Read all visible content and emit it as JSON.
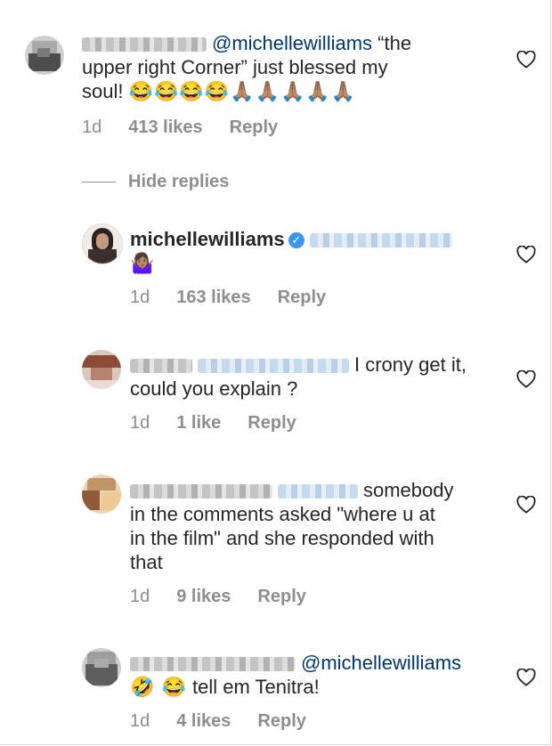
{
  "colors": {
    "mention": "#00376b",
    "meta": "#8e8e8e",
    "text": "#262626",
    "verified": "#3897f0"
  },
  "comments": [
    {
      "mention": "@michellewilliams",
      "text_line1": " “the",
      "text_line2": "upper right Corner” just blessed my",
      "text_line3": "soul!",
      "emoji": "😂😂😂😂🙏🏽🙏🏽🙏🏽🙏🏽🙏🏽",
      "time": "1d",
      "likes": "413 likes",
      "reply": "Reply"
    },
    {
      "username": "michellewilliams",
      "emoji": "🤷🏽‍♀️",
      "time": "1d",
      "likes": "163 likes",
      "reply": "Reply"
    },
    {
      "text_line1": "I crony get it,",
      "text_line2": "could you explain ?",
      "time": "1d",
      "likes": "1 like",
      "reply": "Reply"
    },
    {
      "text_line1": "somebody",
      "text_line2": "in the comments asked \"where u at",
      "text_line3": "in the film\" and she responded with",
      "text_line4": "that",
      "time": "1d",
      "likes": "9 likes",
      "reply": "Reply"
    },
    {
      "mention": "@michellewilliams",
      "emoji": "🤣 😂",
      "text": "tell em Tenitra!",
      "time": "1d",
      "likes": "4 likes",
      "reply": "Reply"
    }
  ],
  "hide_replies": "Hide replies",
  "icons": {
    "heart": "heart-outline-icon",
    "verified": "verified-badge-icon"
  }
}
